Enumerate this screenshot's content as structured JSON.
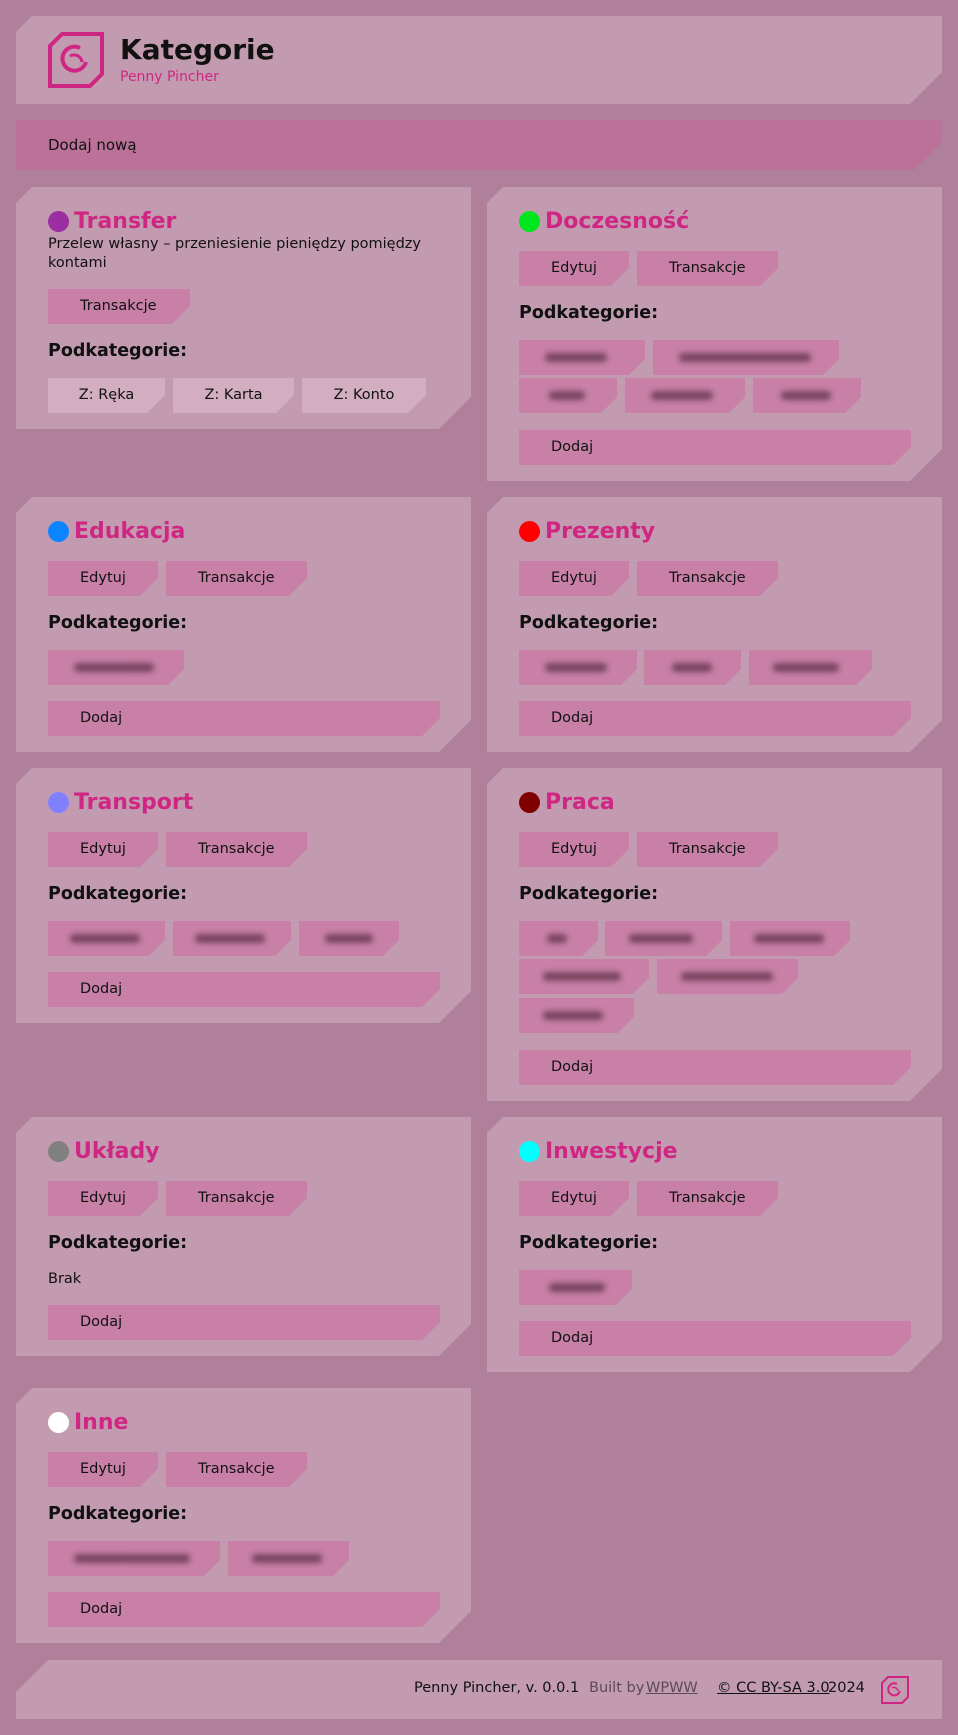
{
  "header": {
    "title": "Kategorie",
    "subtitle": "Penny Pincher"
  },
  "add_new_label": "Dodaj nową",
  "labels": {
    "edit": "Edytuj",
    "transactions": "Transakcje",
    "subcategories": "Podkategorie:",
    "add": "Dodaj",
    "none": "Brak"
  },
  "categories": [
    {
      "name": "Transfer",
      "color": "#9c2ea3",
      "description": "Przelew własny – przeniesienie pieniędzy pomiędzy kontami",
      "subcategories": [
        "Z: Ręka",
        "Z: Karta",
        "Z: Konto"
      ]
    },
    {
      "name": "Doczesność",
      "color": "#00e61e"
    },
    {
      "name": "Edukacja",
      "color": "#0a84ff"
    },
    {
      "name": "Prezenty",
      "color": "#ff0000"
    },
    {
      "name": "Transport",
      "color": "#8080ff"
    },
    {
      "name": "Praca",
      "color": "#800000"
    },
    {
      "name": "Układy",
      "color": "#808080"
    },
    {
      "name": "Inwestycje",
      "color": "#00ffff"
    },
    {
      "name": "Inne",
      "color": "#ffffff"
    }
  ],
  "footer": {
    "app_version": "Penny Pincher, v. 0.0.1",
    "built_by_prefix": "Built by",
    "built_by_link": "WPWW",
    "license_link": "© CC BY-SA 3.0",
    "year": "2024"
  },
  "colors": {
    "accent": "#d02683",
    "background": "#b07f99",
    "card": "#c29bb0",
    "button": "#c880a6"
  },
  "icons": {
    "logo": "penny-pincher-logo-icon"
  }
}
